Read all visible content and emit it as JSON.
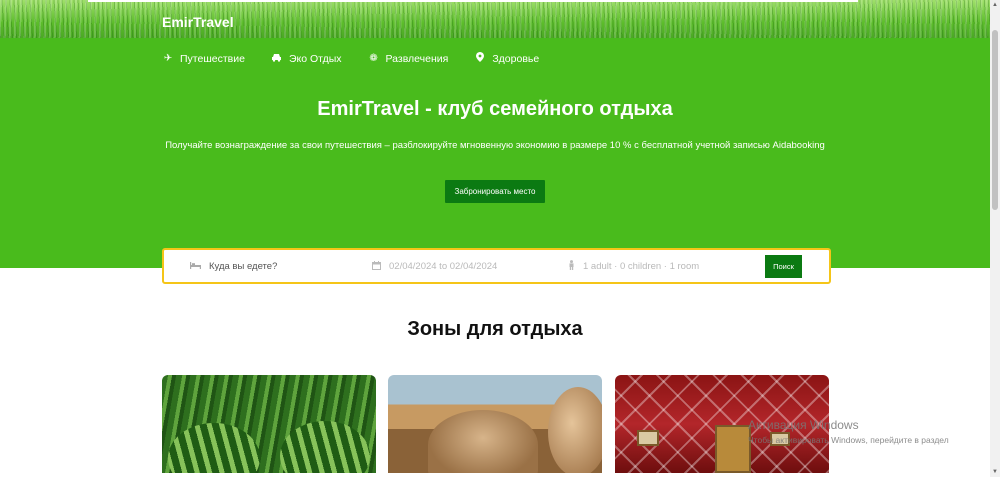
{
  "brand": {
    "logo": "EmirTravel"
  },
  "nav": [
    {
      "icon": "airplane-icon",
      "glyph": "✈",
      "label": "Путешествие"
    },
    {
      "icon": "car-icon",
      "glyph": "🚘",
      "label": "Эко Отдых"
    },
    {
      "icon": "entertainment-icon",
      "glyph": "❁",
      "label": "Развлечения"
    },
    {
      "icon": "location-pin-icon",
      "glyph": "●",
      "label": "Здоровье"
    }
  ],
  "hero": {
    "title": "EmirTravel - клуб семейного отдыха",
    "subtitle": "Получайте вознаграждение за свои путешествия – разблокируйте мгновенную экономию в размере 10 % с бесплатной учетной записью Aidabooking",
    "button": "Забронировать место"
  },
  "search": {
    "destination_placeholder": "Куда вы едете?",
    "dates": "02/04/2024 to 02/04/2024",
    "guests": "1 adult · 0 children · 1 room",
    "button": "Поиск"
  },
  "zones": {
    "title": "Зоны для отдыха"
  },
  "watermark": {
    "title": "Активация Windows",
    "subtitle": "Чтобы активировать Windows, перейдите в раздел"
  },
  "colors": {
    "hero": "#49bb1c",
    "accent_button": "#0b7a12",
    "search_border": "#f5c518"
  }
}
